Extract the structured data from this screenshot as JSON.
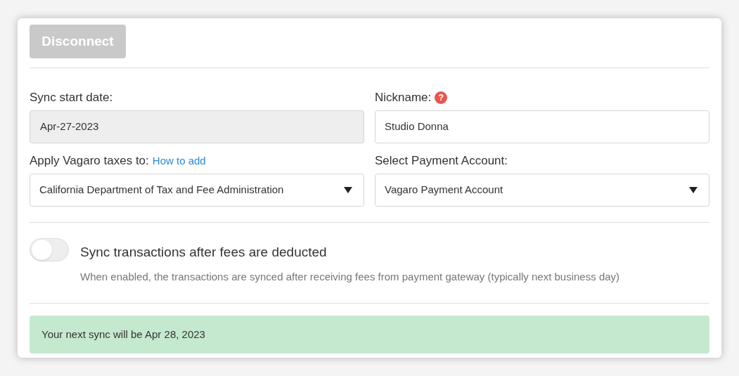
{
  "disconnect_button": {
    "label": "Disconnect",
    "disabled": true
  },
  "fields": [
    {
      "label": "Sync start date:",
      "kind": "text",
      "value": "Apr-27-2023",
      "disabled": true
    },
    {
      "label": "Nickname:",
      "kind": "text",
      "value": "Studio Donna",
      "disabled": false,
      "help": "?"
    },
    {
      "label": "Apply Vagaro taxes to:",
      "link": "How to add",
      "kind": "select",
      "value": "California Department of Tax and Fee Administration",
      "disabled": false
    },
    {
      "label": "Select Payment Account:",
      "kind": "select",
      "value": "Vagaro Payment Account",
      "disabled": false
    }
  ],
  "fee_toggle": {
    "title": "Sync transactions after fees are deducted",
    "description": "When enabled, the transactions are synced after receiving fees from payment gateway (typically next business day)",
    "on": false
  },
  "next_sync_banner": "Your next sync will be Apr 28, 2023"
}
